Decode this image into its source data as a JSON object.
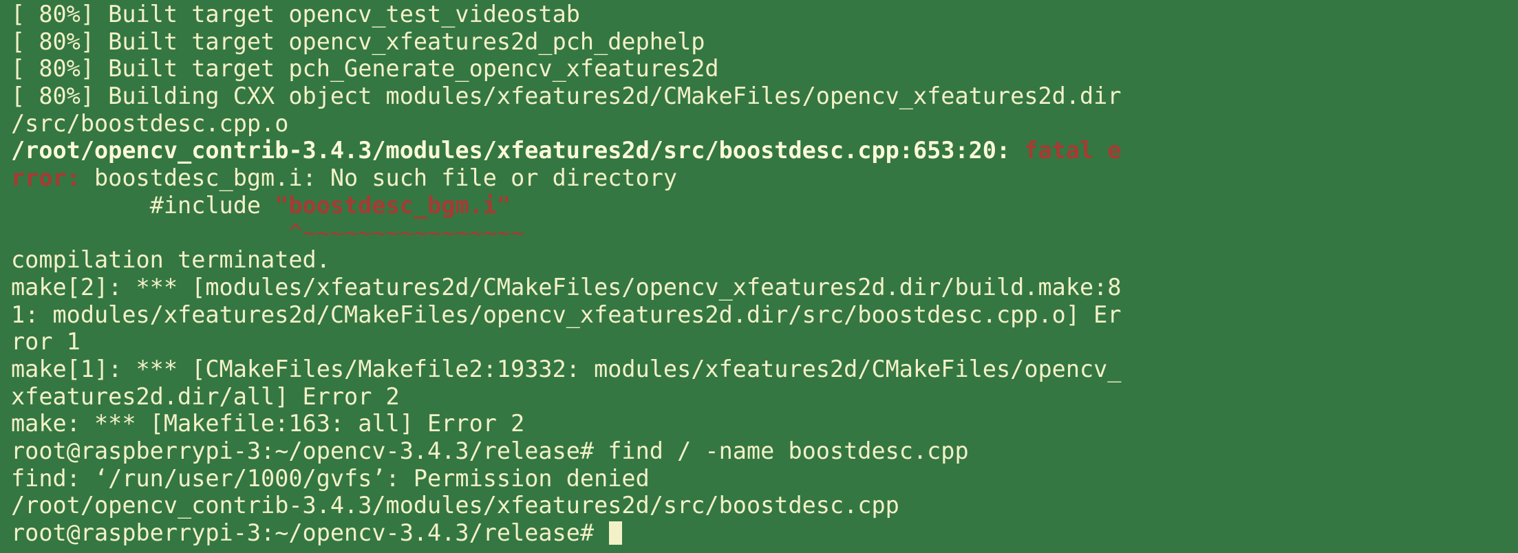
{
  "terminal": {
    "lines": [
      "[ 80%] Built target opencv_test_videostab",
      "[ 80%] Built target opencv_xfeatures2d_pch_dephelp",
      "[ 80%] Built target pch_Generate_opencv_xfeatures2d",
      "[ 80%] Building CXX object modules/xfeatures2d/CMakeFiles/opencv_xfeatures2d.dir",
      "/src/boostdesc.cpp.o"
    ],
    "error_path": "/root/opencv_contrib-3.4.3/modules/xfeatures2d/src/boostdesc.cpp:653:20: ",
    "error_label_part1": "fatal e",
    "error_label_part2": "rror: ",
    "error_message": "boostdesc_bgm.i: No such file or directory",
    "include_indent": "          ",
    "include_directive": "#include ",
    "include_file": "\"boostdesc_bgm.i\"",
    "caret_indent": "                    ",
    "caret_marker": "^~~~~~~~~~~~~~~~~",
    "lines_after": [
      "compilation terminated.",
      "make[2]: *** [modules/xfeatures2d/CMakeFiles/opencv_xfeatures2d.dir/build.make:8",
      "1: modules/xfeatures2d/CMakeFiles/opencv_xfeatures2d.dir/src/boostdesc.cpp.o] Er",
      "ror 1",
      "make[1]: *** [CMakeFiles/Makefile2:19332: modules/xfeatures2d/CMakeFiles/opencv_",
      "xfeatures2d.dir/all] Error 2",
      "make: *** [Makefile:163: all] Error 2",
      "root@raspberrypi-3:~/opencv-3.4.3/release# find / -name boostdesc.cpp",
      "find: ‘/run/user/1000/gvfs’: Permission denied",
      "/root/opencv_contrib-3.4.3/modules/xfeatures2d/src/boostdesc.cpp"
    ],
    "prompt": "root@raspberrypi-3:~/opencv-3.4.3/release# ",
    "colors": {
      "background": "#347742",
      "text": "#f3f1c8",
      "error": "#a83a33"
    }
  }
}
